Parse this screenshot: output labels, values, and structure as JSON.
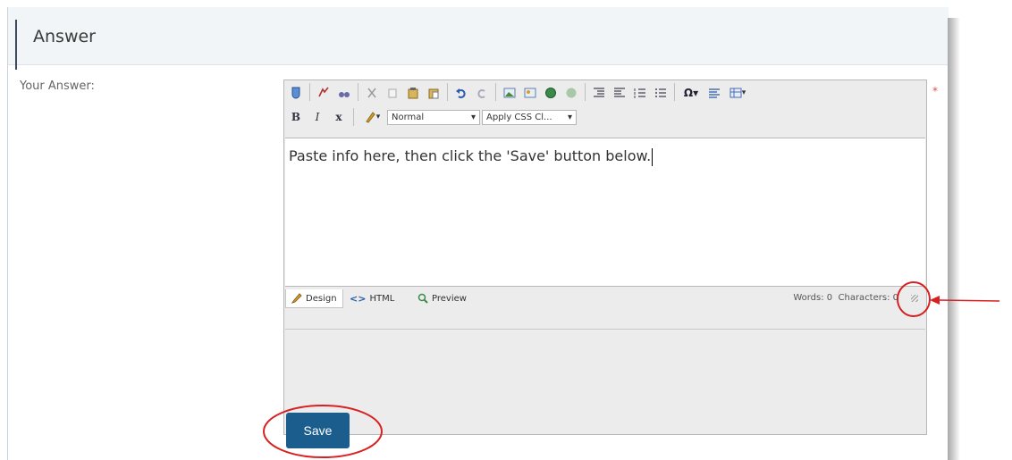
{
  "section": {
    "title": "Answer"
  },
  "form": {
    "label": "Your Answer:",
    "required_mark": "*"
  },
  "toolbar": {
    "row1": [
      "spellcheck-icon",
      "find-icon",
      "replace-icon",
      "cut-icon",
      "copy-icon",
      "paste-icon",
      "paste-plain-icon",
      "undo-icon",
      "redo-icon",
      "insert-image-icon",
      "image-manager-icon",
      "hyperlink-icon",
      "remove-link-icon",
      "indent-icon",
      "outdent-icon",
      "numbered-list-icon",
      "bullet-list-icon",
      "special-char-icon",
      "align-icon",
      "insert-table-icon"
    ],
    "bold": "B",
    "italic": "I",
    "superscript": "x",
    "paragraph_format": "Normal",
    "css_class": "Apply CSS Cl..."
  },
  "editor": {
    "content": "Paste info here, then click the 'Save' button below."
  },
  "modes": {
    "design": "Design",
    "html": "HTML",
    "preview": "Preview"
  },
  "stats": {
    "words": "Words: 0",
    "characters": "Characters: 0"
  },
  "actions": {
    "save": "Save"
  },
  "colors": {
    "save_bg": "#1b5e8e",
    "annotation": "#d82020",
    "header_bg": "#f1f5f8"
  }
}
